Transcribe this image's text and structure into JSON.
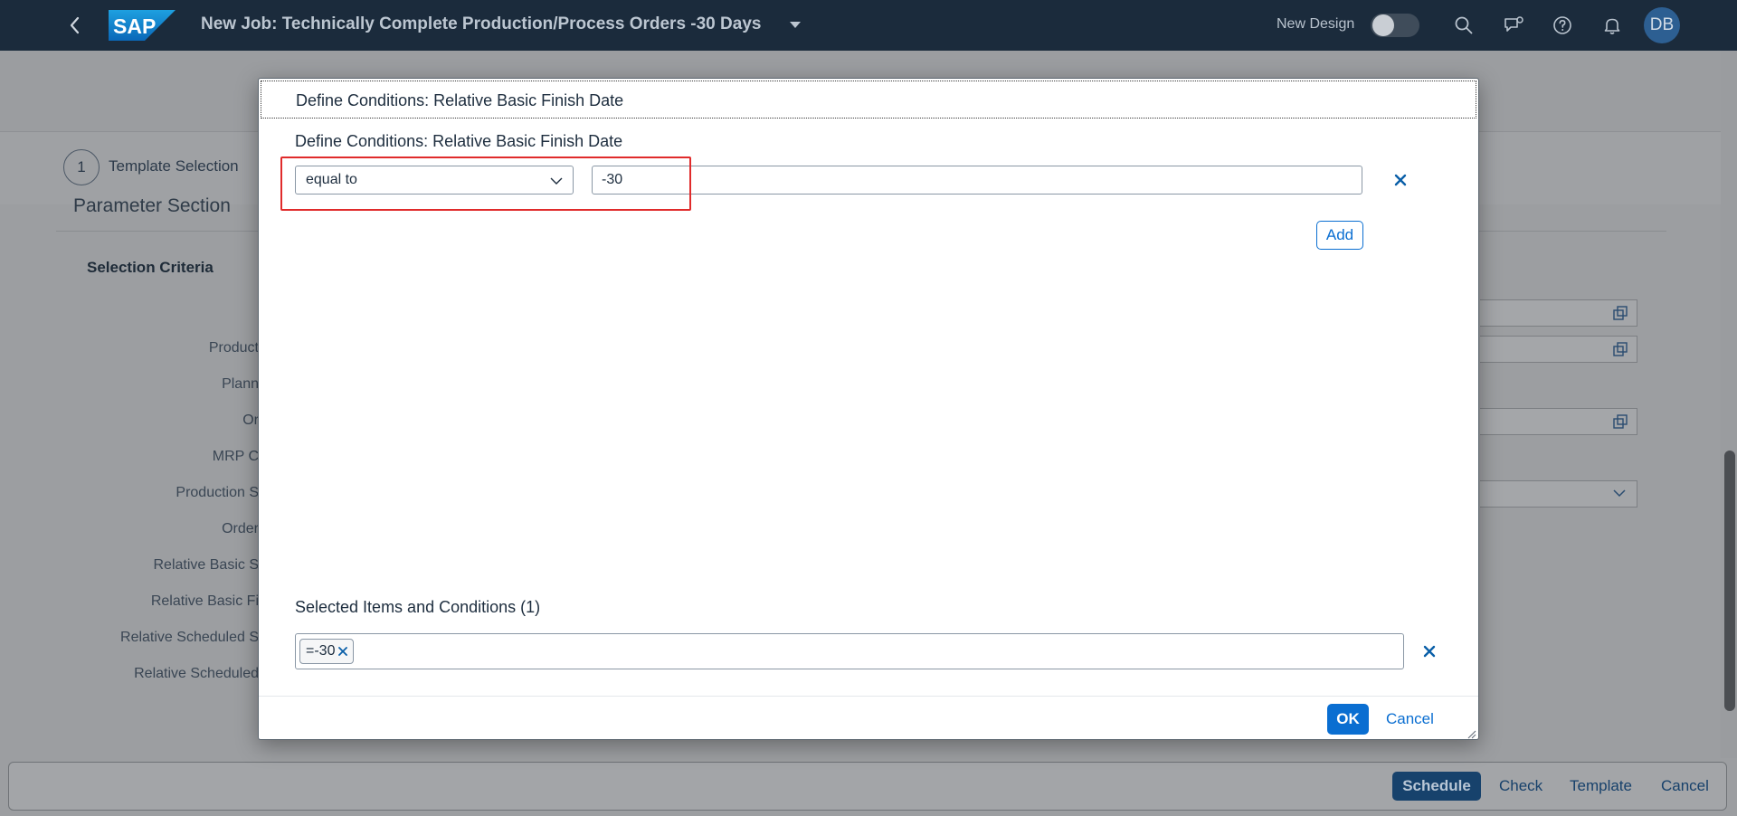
{
  "shell": {
    "title": "New Job: Technically Complete Production/Process Orders -30 Days",
    "new_design_label": "New Design",
    "avatar_initials": "DB",
    "logo_text": "SAP"
  },
  "background_page": {
    "step_number": "1",
    "step_label": "Template Selection",
    "parameter_section_title": "Parameter Section",
    "selection_criteria_label": "Selection Criteria",
    "field_labels": [
      "Product",
      "Plann",
      "Or",
      "MRP C",
      "Production S",
      "Order",
      "Relative Basic S",
      "Relative Basic Fi",
      "Relative Scheduled S",
      "Relative Scheduled"
    ]
  },
  "footer": {
    "schedule": "Schedule",
    "check": "Check",
    "template": "Template",
    "cancel": "Cancel"
  },
  "dialog": {
    "header_title": "Define Conditions: Relative Basic Finish Date",
    "subtitle": "Define Conditions: Relative Basic Finish Date",
    "condition": {
      "operator": "equal to",
      "value": "-30"
    },
    "add_label": "Add",
    "selected_title": "Selected Items and Conditions (1)",
    "tokens": [
      "=-30"
    ],
    "ok_label": "OK",
    "cancel_label": "Cancel"
  },
  "colors": {
    "shell_bg": "#1b2b3c",
    "accent": "#0a6ed1",
    "highlight": "#e02b2b"
  }
}
